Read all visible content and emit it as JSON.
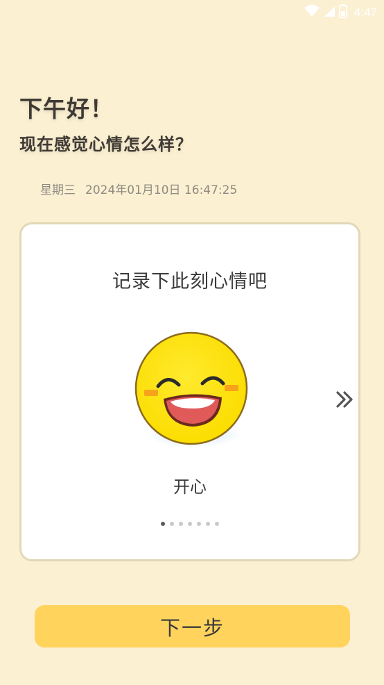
{
  "status_bar": {
    "time": "4:47",
    "icons": [
      "wifi-icon",
      "signal-icon",
      "battery-icon"
    ]
  },
  "greeting": {
    "title": "下午好！",
    "subtitle": "现在感觉心情怎么样？"
  },
  "datetime": {
    "weekday": "星期三",
    "timestamp": "2024年01月10日 16:47:25"
  },
  "mood_card": {
    "title": "记录下此刻心情吧",
    "mood_icon": "laughing-face-icon",
    "mood_label": "开心",
    "next_icon": "double-chevron-right-icon",
    "pager": {
      "total": 7,
      "active_index": 0
    }
  },
  "next_button": {
    "label": "下一步"
  },
  "colors": {
    "background": "#FBF0D2",
    "card_border": "#E2D8B6",
    "button": "#FFD35C",
    "emoji_face": "#FFE000",
    "text_dark": "#3F3A34",
    "text_muted": "#8F8A82"
  }
}
